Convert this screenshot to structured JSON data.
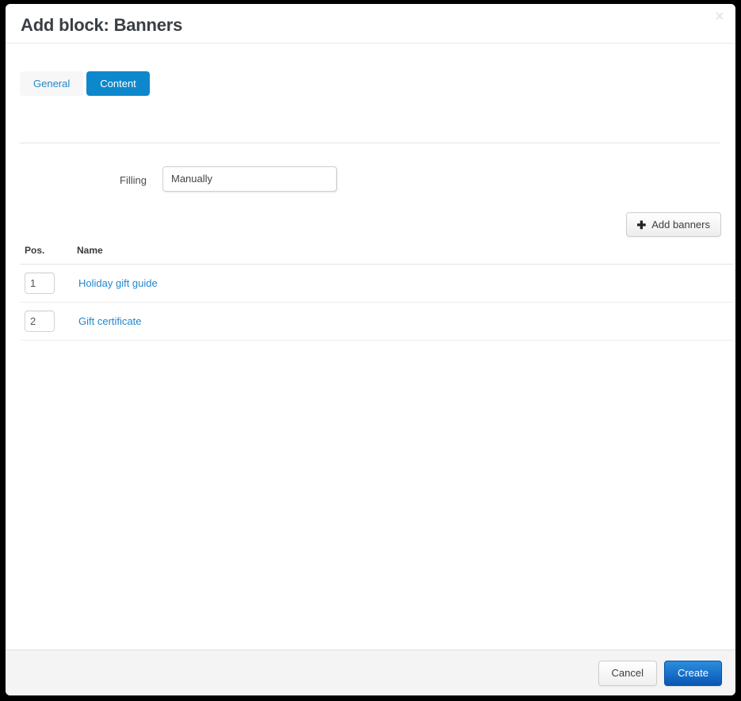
{
  "dialog": {
    "title": "Add block: Banners",
    "close_icon": "close-icon",
    "close_glyph": "✕"
  },
  "tabs": [
    {
      "label": "General",
      "active": false
    },
    {
      "label": "Content",
      "active": true
    }
  ],
  "form": {
    "filling": {
      "label": "Filling",
      "value": "Manually",
      "options": [
        "Manually"
      ]
    }
  },
  "toolbar": {
    "add_banners_label": "Add banners",
    "add_banners_icon": "plus-icon",
    "plus_glyph": "✚"
  },
  "table": {
    "columns": [
      "Pos.",
      "Name"
    ],
    "rows": [
      {
        "pos": "1",
        "name": "Holiday gift guide"
      },
      {
        "pos": "2",
        "name": "Gift certificate"
      }
    ]
  },
  "footer": {
    "cancel_label": "Cancel",
    "create_label": "Create"
  },
  "colors": {
    "accent_blue": "#0e88cc",
    "link_blue": "#2387cc",
    "create_blue": "#0a56b5",
    "title_gray": "#3a3f44",
    "footer_bg": "#f4f4f4"
  }
}
